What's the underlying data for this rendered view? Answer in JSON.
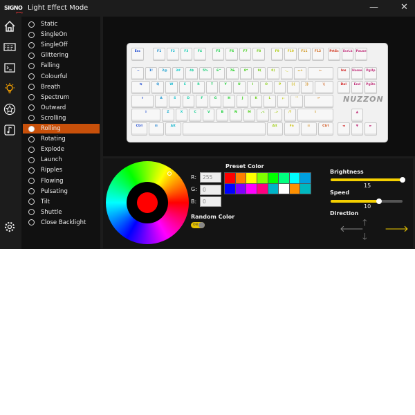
{
  "app": {
    "logo": "SIGNO",
    "logo_sub": "gaming",
    "title": "Light Effect Mode",
    "minimize": "—",
    "close": "✕"
  },
  "iconbar": [
    "home-icon",
    "keyboard-icon",
    "macro-icon",
    "light-bulb-icon",
    "star-icon",
    "music-icon",
    "settings-icon"
  ],
  "modes": [
    "Static",
    "SingleOn",
    "SingleOff",
    "Glittering",
    "Falling",
    "Colourful",
    "Breath",
    "Spectrum",
    "Outward",
    "Scrolling",
    "Rolling",
    "Rotating",
    "Explode",
    "Launch",
    "Ripples",
    "Flowing",
    "Pulsating",
    "Tilt",
    "Shuttle",
    "Close Backlight"
  ],
  "selected_mode": "Rolling",
  "keyboard": {
    "brand": "NUZZON",
    "rows": [
      [
        "Esc",
        "F1",
        "F2",
        "F3",
        "F4",
        "F5",
        "F6",
        "F7",
        "F8",
        "F9",
        "F10",
        "F11",
        "F12",
        "PrtSc",
        "ScrLk",
        "Pause"
      ],
      [
        "`~",
        "1!",
        "2@",
        "3#",
        "4$",
        "5%",
        "6^",
        "7&",
        "8*",
        "9(",
        "0)",
        "-_",
        "=+",
        "←",
        "Ins",
        "Home",
        "PgUp"
      ],
      [
        "⇆",
        "Q",
        "W",
        "E",
        "R",
        "T",
        "Y",
        "U",
        "I",
        "O",
        "P",
        "[{",
        "]}",
        "\\|",
        "Del",
        "End",
        "PgDn"
      ],
      [
        "⇪",
        "A",
        "S",
        "D",
        "F",
        "G",
        "H",
        "J",
        "K",
        "L",
        ";:",
        "'\"",
        "↵"
      ],
      [
        "⇧",
        "Z",
        "X",
        "C",
        "V",
        "B",
        "N",
        "M",
        ",<",
        ".>",
        "/?",
        "⇧",
        "▲"
      ],
      [
        "Ctrl",
        "⊞",
        "Alt",
        "",
        "Alt",
        "Fn",
        "☰",
        "Ctrl",
        "◄",
        "▼",
        "►"
      ]
    ]
  },
  "color": {
    "r_label": "R:",
    "g_label": "G:",
    "b_label": "B:",
    "r": "255",
    "g": "0",
    "b": "0",
    "current": "#ff0000",
    "preset_label": "Preset Color",
    "presets": [
      "#ff0000",
      "#ff7f00",
      "#ffff00",
      "#80ff00",
      "#00ff00",
      "#00ff80",
      "#00ffff",
      "#00a0e0",
      "#0000ff",
      "#8000ff",
      "#ff00ff",
      "#ff0080",
      "#00b4c8",
      "#ffffff",
      "#ff9000",
      "#00b8c0"
    ],
    "random_label": "Random Color",
    "random_toggle": "ON",
    "random_on": true
  },
  "brightness": {
    "label": "Brightness",
    "value": "15",
    "fraction": 1.0
  },
  "speed": {
    "label": "Speed",
    "value": "10",
    "fraction": 0.67
  },
  "direction": {
    "label": "Direction",
    "selected": "right",
    "up": "🡑",
    "down": "🡓",
    "left": "🡐",
    "right": "🡒"
  },
  "accent": "#c8500a",
  "slider_color": "#f5d000"
}
